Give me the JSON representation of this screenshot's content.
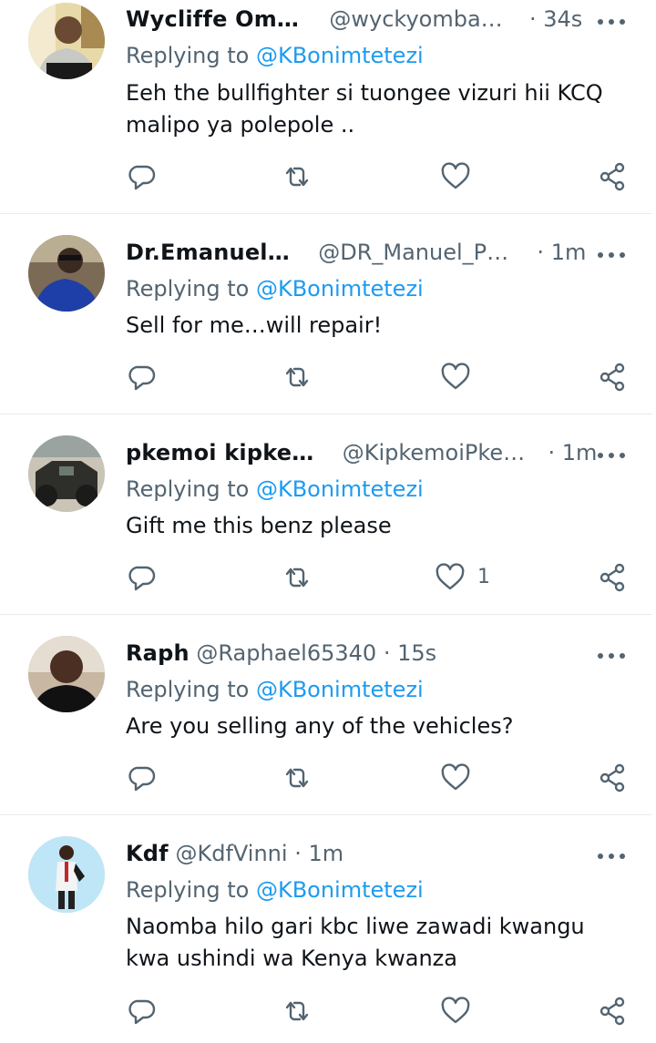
{
  "tweets": [
    {
      "name": "Wycliffe Om…",
      "handle": "@wyckyomba…",
      "dot": "·",
      "time": "34s",
      "replying_label": "Replying to",
      "replying_to": "@KBonimtetezi",
      "text_lines": [
        "Eeh the bullfighter si tuongee vizuri hii KCQ",
        "malipo ya polepole .."
      ],
      "like_count": ""
    },
    {
      "name": "Dr.Emanuel…",
      "handle": "@DR_Manuel_P…",
      "dot": "·",
      "time": "1m",
      "replying_label": "Replying to",
      "replying_to": "@KBonimtetezi",
      "text_lines": [
        "Sell for me…will repair!"
      ],
      "like_count": ""
    },
    {
      "name": "pkemoi kipke…",
      "handle": "@KipkemoiPke…",
      "dot": "·",
      "time": "1m",
      "replying_label": "Replying to",
      "replying_to": "@KBonimtetezi",
      "text_lines": [
        "Gift me this benz please"
      ],
      "like_count": "1"
    },
    {
      "name": "Raph",
      "handle": "@Raphael65340",
      "dot": "·",
      "time": "15s",
      "replying_label": "Replying to",
      "replying_to": "@KBonimtetezi",
      "text_lines": [
        "Are you selling any of the vehicles?"
      ],
      "like_count": ""
    },
    {
      "name": "Kdf",
      "handle": "@KdfVinni",
      "dot": "·",
      "time": "1m",
      "replying_label": "Replying to",
      "replying_to": "@KBonimtetezi",
      "text_lines": [
        "Naomba hilo gari kbc liwe zawadi kwangu",
        "kwa ushindi wa Kenya kwanza"
      ],
      "like_count": ""
    }
  ],
  "icons": {
    "reply": "reply-icon",
    "retweet": "retweet-icon",
    "like": "heart-icon",
    "share": "share-icon",
    "more": "more-options-icon"
  },
  "colors": {
    "text": "#0f1419",
    "secondary": "#536471",
    "link": "#1d9bf0",
    "divider": "#e6ecf0"
  }
}
